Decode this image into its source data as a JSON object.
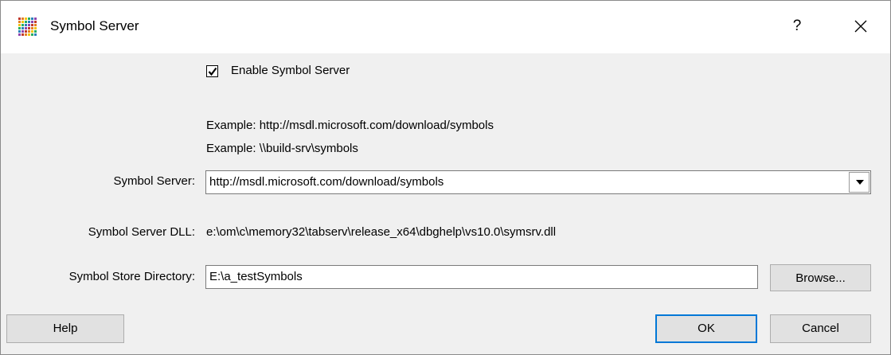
{
  "window": {
    "title": "Symbol Server",
    "help_glyph": "?",
    "close_glyph": "✕"
  },
  "icons": {
    "app": "app-grid-icon",
    "help": "question-icon",
    "close": "close-icon",
    "dropdown": "chevron-down-icon",
    "check": "checkmark-icon"
  },
  "enable": {
    "label": "Enable Symbol Server",
    "checked": true
  },
  "examples": [
    "Example: http://msdl.microsoft.com/download/symbols",
    "Example: \\\\build-srv\\symbols"
  ],
  "symbol_server": {
    "label": "Symbol Server:",
    "value": "http://msdl.microsoft.com/download/symbols"
  },
  "symbol_server_dll": {
    "label": "Symbol Server DLL:",
    "value": "e:\\om\\c\\memory32\\tabserv\\release_x64\\dbghelp\\vs10.0\\symsrv.dll"
  },
  "symbol_store": {
    "label": "Symbol Store Directory:",
    "value": "E:\\a_testSymbols"
  },
  "buttons": {
    "browse": "Browse...",
    "help": "Help",
    "ok": "OK",
    "cancel": "Cancel"
  },
  "colors": {
    "dialog_bg": "#f0f0f0",
    "titlebar_bg": "#ffffff",
    "default_button_border": "#0078d7"
  }
}
